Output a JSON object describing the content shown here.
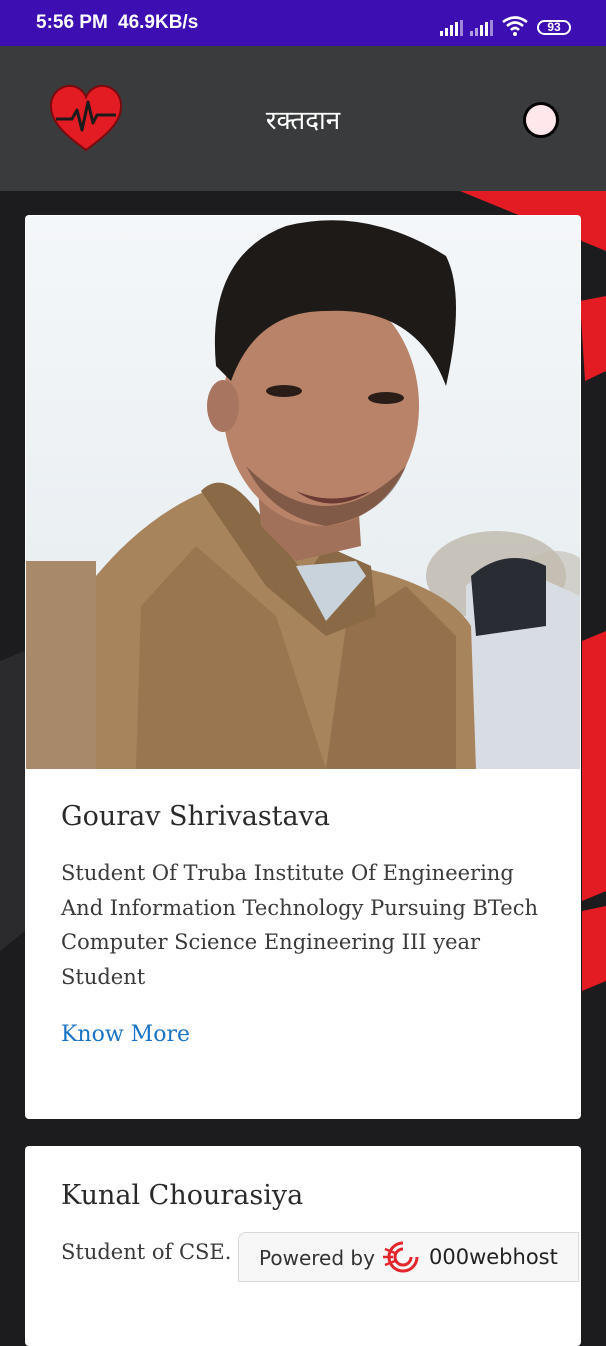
{
  "status_bar": {
    "time": "5:56 PM",
    "speed": "46.9KB/s",
    "battery": "93"
  },
  "app_bar": {
    "title": "रक्तदान",
    "logo_icon": "heart-pulse-icon",
    "toggle_icon": "theme-toggle-icon"
  },
  "colors": {
    "status_bar": "#3d0fb3",
    "app_bar": "#3a3b3d",
    "accent_red": "#e31b23",
    "link": "#1a73c4"
  },
  "members": [
    {
      "name": "Gourav Shrivastava",
      "description": "Student Of Truba Institute Of Engineering And Information Technology Pursuing BTech Computer Science Engineering III year Student",
      "link": "Know More"
    },
    {
      "name": "Kunal Chourasiya",
      "description": "Student of CSE."
    }
  ],
  "badge": {
    "powered_by": "Powered by",
    "host": "000webhost"
  }
}
